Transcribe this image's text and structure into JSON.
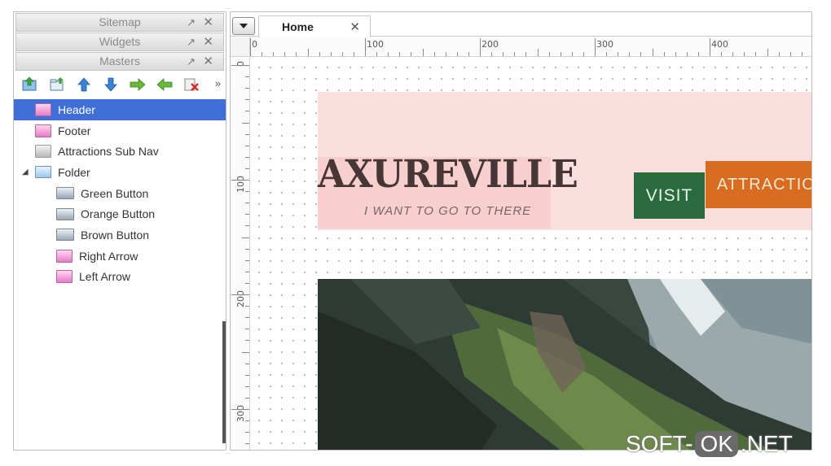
{
  "left_panel": {
    "panes": [
      {
        "title": "Sitemap"
      },
      {
        "title": "Widgets"
      },
      {
        "title": "Masters"
      }
    ],
    "pane_pop_glyph": "↗",
    "pane_close_glyph": "✕",
    "toolbar": {
      "icons": [
        "add-master-icon",
        "add-folder-icon",
        "move-up-icon",
        "move-down-icon",
        "indent-icon",
        "outdent-icon",
        "delete-icon"
      ],
      "more_glyph": "»"
    },
    "masters": [
      {
        "label": "Header",
        "icon": "pink-page-icon",
        "selected": true
      },
      {
        "label": "Footer",
        "icon": "pink-page-icon"
      },
      {
        "label": "Attractions Sub Nav",
        "icon": "gray-page-icon"
      },
      {
        "label": "Folder",
        "icon": "folder-icon",
        "expanded": true
      },
      {
        "label": "Green Button",
        "icon": "button-icon",
        "parent": "Folder"
      },
      {
        "label": "Orange Button",
        "icon": "button-icon",
        "parent": "Folder"
      },
      {
        "label": "Brown Button",
        "icon": "button-icon",
        "parent": "Folder"
      },
      {
        "label": "Right Arrow",
        "icon": "pink-page-icon",
        "parent": "Folder"
      },
      {
        "label": "Left Arrow",
        "icon": "pink-page-icon",
        "parent": "Folder"
      }
    ],
    "folder_toggle": "◢"
  },
  "canvas_area": {
    "tab": {
      "label": "Home",
      "close_glyph": "✕"
    },
    "rulers": {
      "horizontal_labels": [
        "0",
        "100",
        "200",
        "300",
        "400"
      ],
      "vertical_labels": [
        "0",
        "100",
        "200",
        "300"
      ]
    }
  },
  "page": {
    "logo_title": "AXUREVILLE",
    "logo_tagline": "I WANT TO GO TO THERE",
    "nav_visit": "VISIT",
    "nav_attractions": "ATTRACTIONS",
    "colors": {
      "header_band": "#fbdfdf",
      "visit_button": "#2a6b3e",
      "attractions_button": "#d86d22",
      "logo_text": "#473636",
      "selection": "#3f6fd6"
    }
  },
  "watermark": {
    "part1": "SOFT-",
    "part2": "OK",
    "part3": ".NET"
  }
}
